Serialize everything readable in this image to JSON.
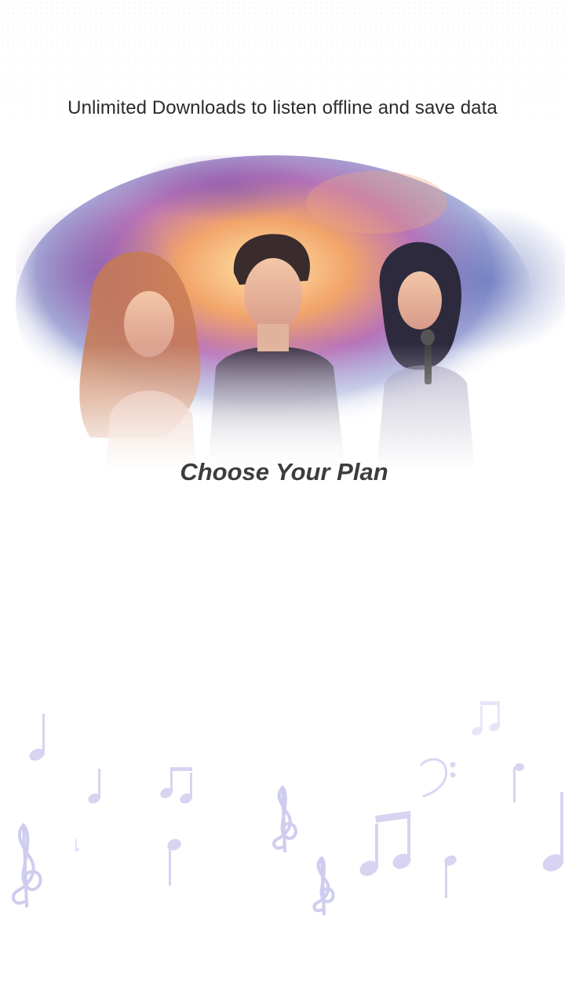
{
  "promo": {
    "tagline": "Unlimited Downloads to listen offline and save data",
    "plan_heading": "Choose Your Plan"
  },
  "icons": {
    "hero": "artist-collage-image",
    "notes": [
      "music-note-icon",
      "treble-clef-icon",
      "bass-clef-icon",
      "beamed-notes-icon"
    ]
  },
  "colors": {
    "background": "#ffffff",
    "text_primary": "#2b2b2b",
    "heading": "#3d3d3d",
    "note_tint": "#c9c8ec"
  }
}
